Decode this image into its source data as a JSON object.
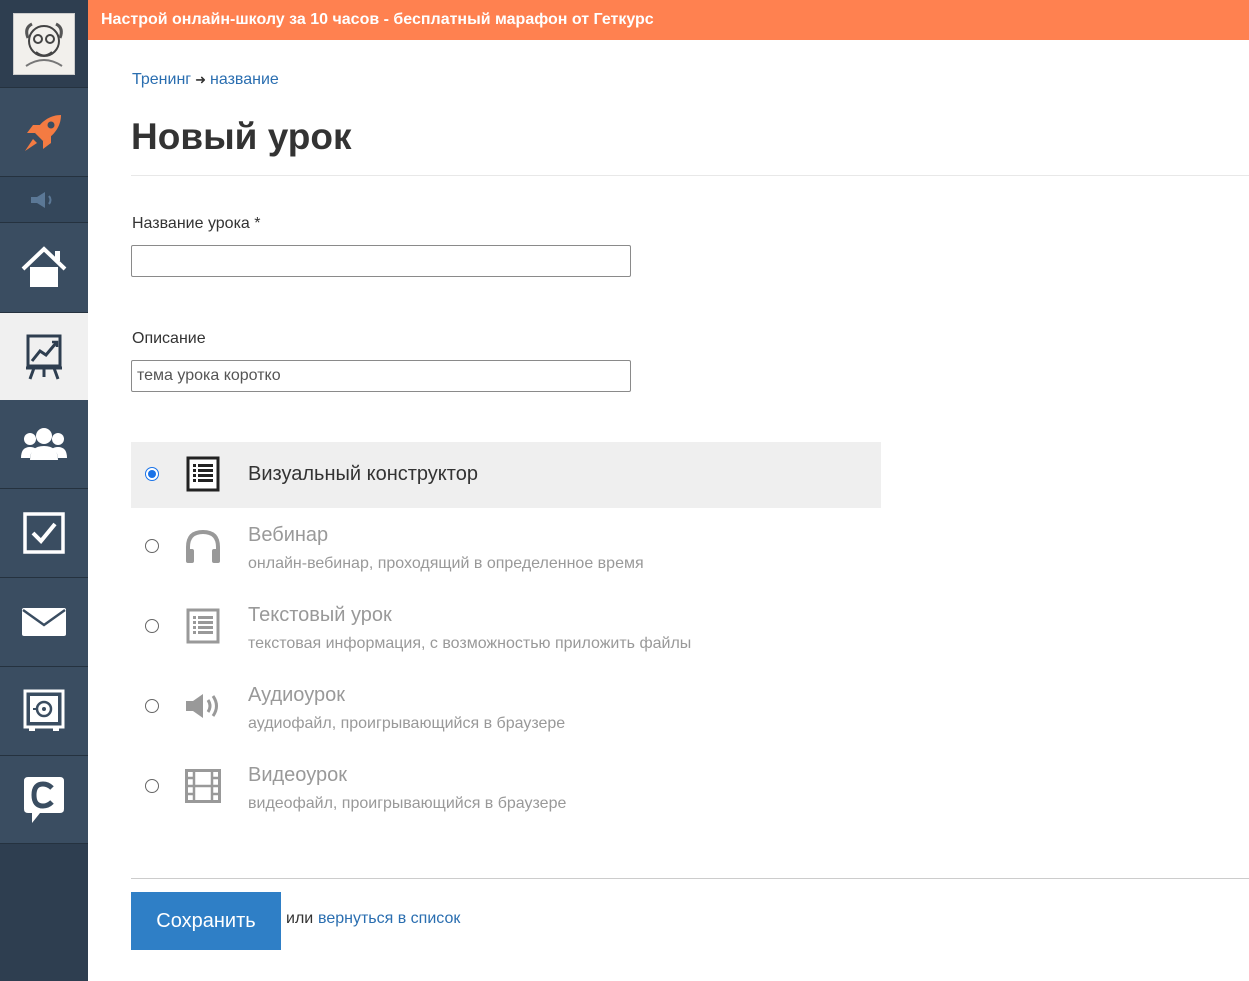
{
  "banner": {
    "text": "Настрой онлайн-школу за 10 часов - бесплатный марафон от Геткурс"
  },
  "sidebar": {
    "items": [
      {
        "name": "avatar"
      },
      {
        "name": "rocket-icon"
      },
      {
        "name": "speaker-icon"
      },
      {
        "name": "home-icon"
      },
      {
        "name": "training-chart-icon",
        "active": true
      },
      {
        "name": "users-icon"
      },
      {
        "name": "tasks-checkbox-icon"
      },
      {
        "name": "mail-icon"
      },
      {
        "name": "safe-icon"
      },
      {
        "name": "chat-c-icon"
      }
    ],
    "accent": "#f47b42"
  },
  "breadcrumb": {
    "first": "Тренинг",
    "arrow": "➜",
    "second": "название"
  },
  "page_title": "Новый урок",
  "form": {
    "name_label": "Название урока *",
    "name_value": "",
    "desc_label": "Описание",
    "desc_placeholder": "тема урока коротко"
  },
  "lesson_types": [
    {
      "title": "Визуальный конструктор",
      "desc": "",
      "icon": "list-icon",
      "selected": true
    },
    {
      "title": "Вебинар",
      "desc": "онлайн-вебинар, проходящий в определенное время",
      "icon": "headphones-icon",
      "selected": false
    },
    {
      "title": "Текстовый урок",
      "desc": "текстовая информация, с возможностью приложить файлы",
      "icon": "text-list-icon",
      "selected": false
    },
    {
      "title": "Аудиоурок",
      "desc": "аудиофайл, проигрывающийся в браузере",
      "icon": "speaker-icon",
      "selected": false
    },
    {
      "title": "Видеоурок",
      "desc": "видеофайл, проигрывающийся в браузере",
      "icon": "film-icon",
      "selected": false
    }
  ],
  "footer": {
    "save_label": "Сохранить",
    "or": "или",
    "back_link": "вернуться в список"
  },
  "colors": {
    "banner": "#ff8150",
    "sidebar": "#2e3e50",
    "primary": "#2f7fc6",
    "link": "#2a6eb0"
  }
}
